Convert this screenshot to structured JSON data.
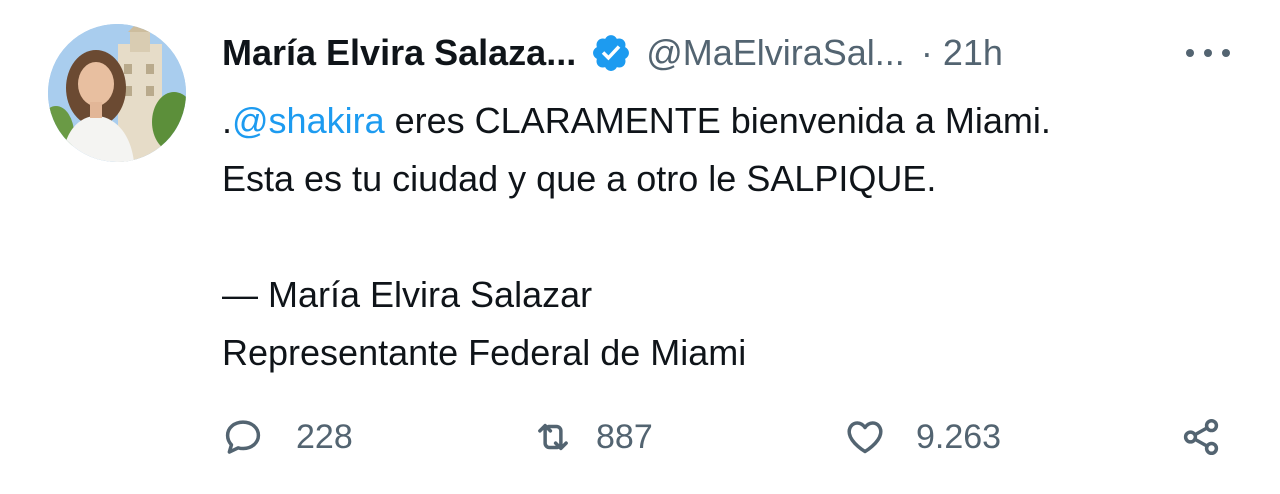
{
  "tweet": {
    "author": {
      "display_name": "María Elvira Salaza...",
      "handle": "@MaElviraSal...",
      "separator": "·",
      "time": "21h",
      "verified": true,
      "avatar_icon": "profile-photo"
    },
    "body": {
      "mention": "@shakira",
      "line1_prefix": ".",
      "line1_rest": " eres CLARAMENTE bienvenida a Miami.",
      "line2": "Esta es tu ciudad y que a otro le SALPIQUE.",
      "line4": "— María Elvira Salazar",
      "line5": "Representante Federal de Miami"
    },
    "actions": {
      "replies": "228",
      "retweets": "887",
      "likes": "9.263"
    },
    "icons": {
      "more": "more-horizontal-icon",
      "reply": "reply-icon",
      "retweet": "retweet-icon",
      "like": "heart-icon",
      "share": "share-icon"
    },
    "colors": {
      "verified_blue": "#1d9bf0",
      "mention_blue": "#1d9bf0",
      "secondary_text": "#536471"
    }
  }
}
